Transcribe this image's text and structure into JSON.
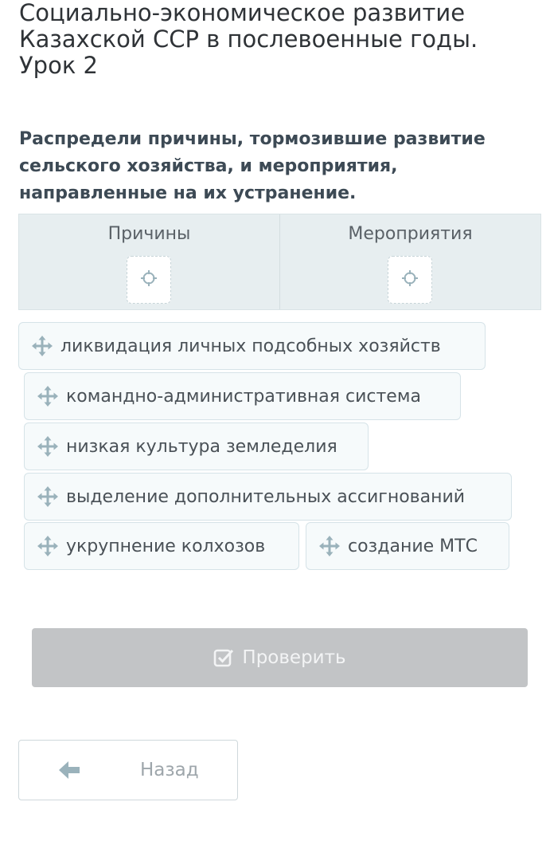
{
  "lesson": {
    "title": "Социально-экономическое развитие Казахской ССР в послевоенные годы. Урок 2"
  },
  "task": {
    "title": "Распредели причины, тормозившие развитие сельского хозяйства, и мероприятия, направленные на их устранение."
  },
  "table": {
    "columns": [
      {
        "header": "Причины",
        "slot_icon": "target-icon"
      },
      {
        "header": "Мероприятия",
        "slot_icon": "target-icon"
      }
    ]
  },
  "options": [
    {
      "label": "ликвидация личных подсобных хозяйств",
      "icon": "move-icon"
    },
    {
      "label": "командно-административная система",
      "icon": "move-icon"
    },
    {
      "label": "низкая культура земледелия",
      "icon": "move-icon"
    },
    {
      "label": "выделение дополнительных ассигнований",
      "icon": "move-icon"
    },
    {
      "label": "укрупнение колхозов",
      "icon": "move-icon"
    },
    {
      "label": "создание МТС",
      "icon": "move-icon"
    }
  ],
  "actions": {
    "check_label": "Проверить",
    "check_icon": "checkbox-icon",
    "back_label": "Назад",
    "back_icon": "arrow-left-icon"
  },
  "colors": {
    "panel_bg": "#e7eef0",
    "chip_bg": "#f6fafb",
    "button_disabled": "#c2c4c6",
    "icon": "#9ab2bb"
  }
}
